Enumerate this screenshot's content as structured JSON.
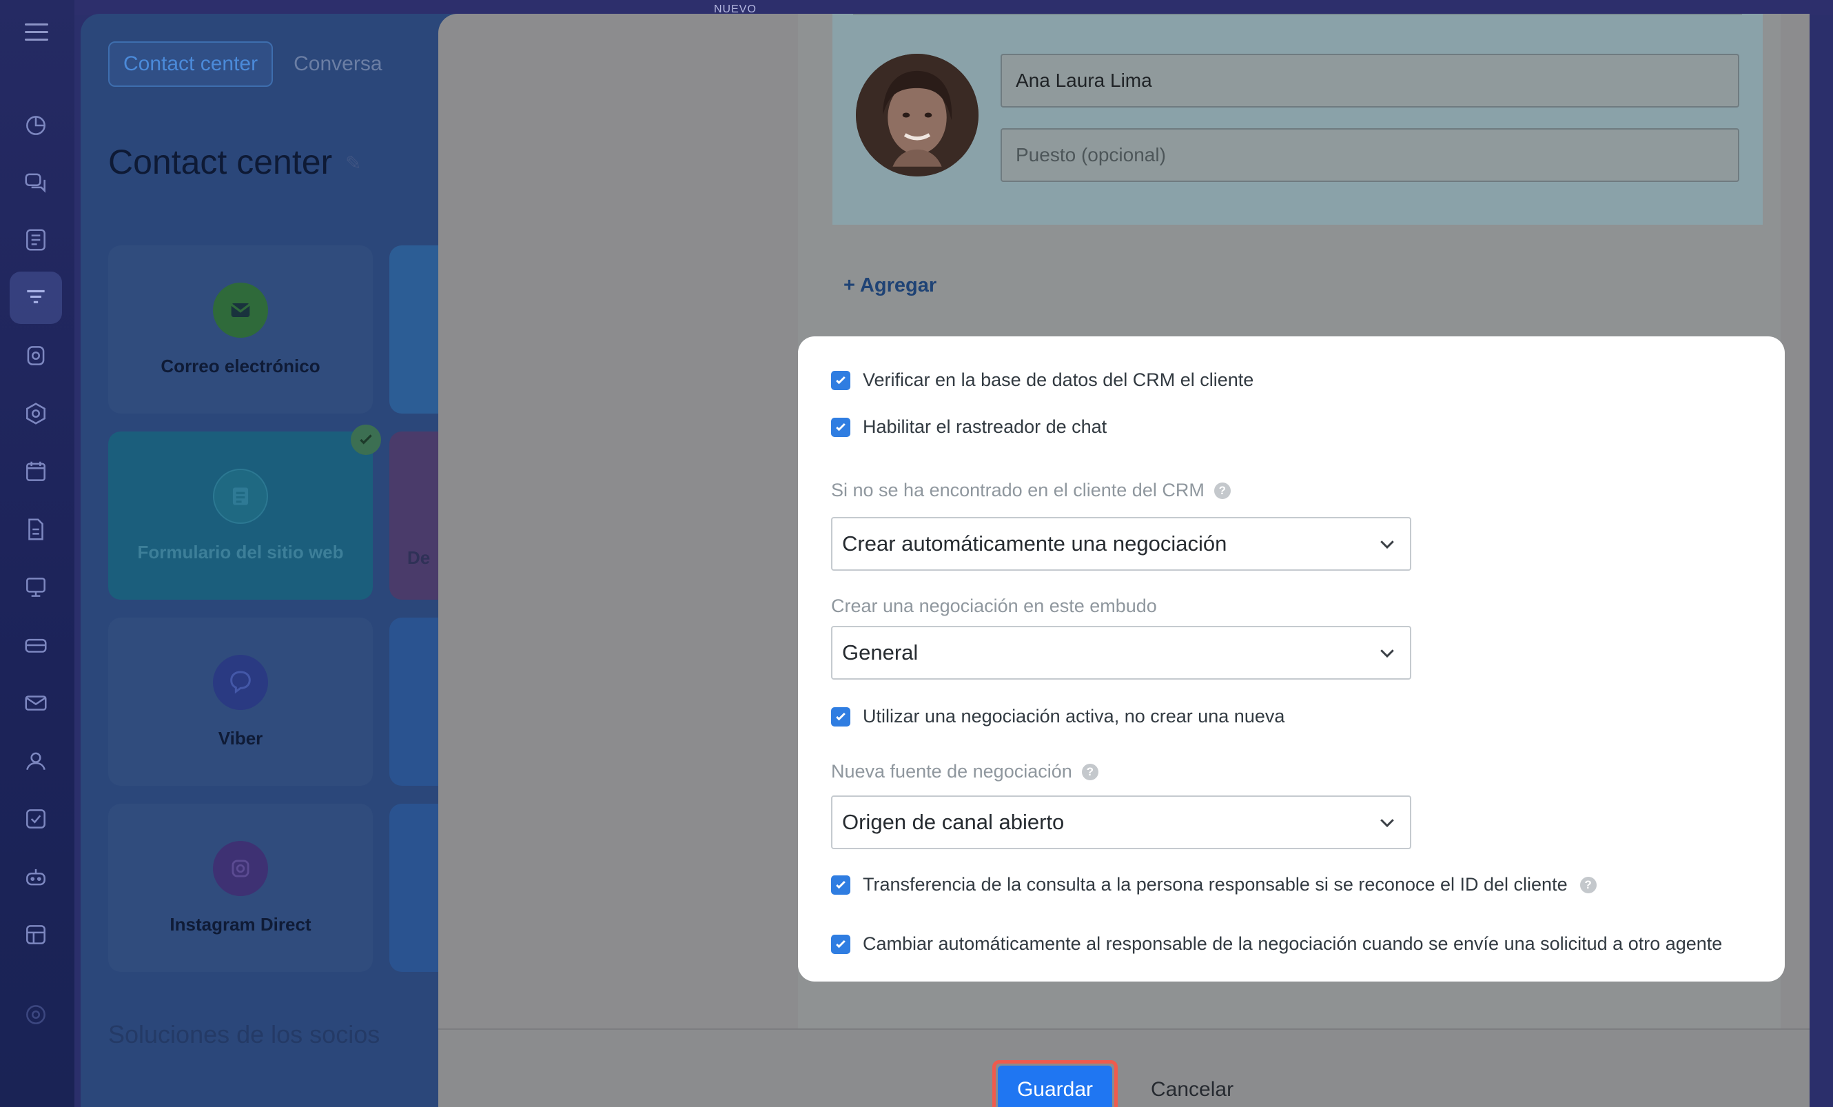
{
  "topbar": {
    "new_label": "NUEVO"
  },
  "sidebar": {
    "items": [
      {
        "icon": "chart-icon"
      },
      {
        "icon": "chat-icon"
      },
      {
        "icon": "feed-icon"
      },
      {
        "icon": "funnel-icon",
        "active": true
      },
      {
        "icon": "cube-icon"
      },
      {
        "icon": "hexagon-icon"
      },
      {
        "icon": "calendar-icon"
      },
      {
        "icon": "document-icon"
      },
      {
        "icon": "presentation-icon"
      },
      {
        "icon": "inbox-icon"
      },
      {
        "icon": "mail-icon"
      },
      {
        "icon": "contacts-icon"
      },
      {
        "icon": "checklist-icon"
      },
      {
        "icon": "robot-icon"
      },
      {
        "icon": "table-icon"
      },
      {
        "icon": "help-icon"
      }
    ]
  },
  "base": {
    "tabs": [
      "Contact center",
      "Conversa"
    ],
    "title": "Contact center",
    "cards": [
      {
        "label": "Correo electrónico",
        "icon": "mail-icon"
      },
      {
        "label": "Formulario del sitio web",
        "icon": "form-icon"
      },
      {
        "label": "Viber",
        "icon": "viber-icon"
      },
      {
        "label": "Instagram Direct",
        "icon": "instagram-icon"
      }
    ],
    "stub_label": "De",
    "partners": "Soluciones de los socios"
  },
  "slider": {
    "name_value": "Ana Laura Lima",
    "position_placeholder": "Puesto (opcional)",
    "add_label": "+ Agregar"
  },
  "settings": {
    "check_crm": "Verificar en la base de datos del CRM el cliente",
    "check_tracker": "Habilitar el rastreador de chat",
    "not_found_label": "Si no se ha encontrado en el cliente del CRM",
    "not_found_value": "Crear automáticamente una negociación",
    "pipeline_label": "Crear una negociación en este embudo",
    "pipeline_value": "General",
    "check_active_deal": "Utilizar una negociación activa, no crear una nueva",
    "source_label": "Nueva fuente de negociación",
    "source_value": "Origen de canal abierto",
    "check_transfer": "Transferencia de la consulta a la persona responsable si se reconoce el ID del cliente",
    "check_change_responsible": "Cambiar automáticamente al responsable de la negociación cuando se envíe una solicitud a otro agente"
  },
  "footer": {
    "save": "Guardar",
    "cancel": "Cancelar"
  },
  "colors": {
    "accent": "#1f76f2",
    "checkbox": "#2f7de1",
    "highlight": "#ef5b4d"
  }
}
